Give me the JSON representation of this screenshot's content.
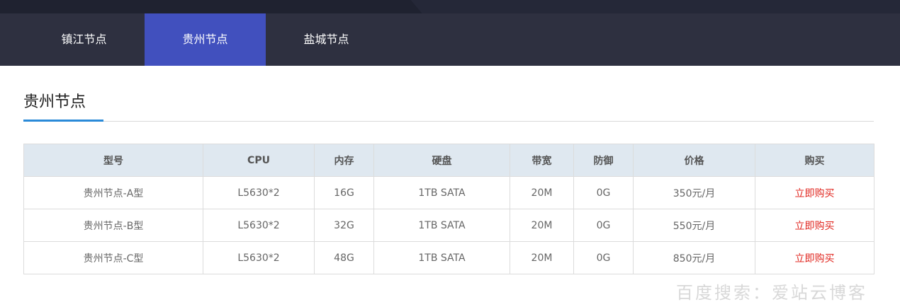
{
  "tabs": [
    {
      "label": "镇江节点",
      "active": false
    },
    {
      "label": "贵州节点",
      "active": true
    },
    {
      "label": "盐城节点",
      "active": false
    }
  ],
  "section": {
    "title": "贵州节点"
  },
  "table": {
    "headers": [
      "型号",
      "CPU",
      "内存",
      "硬盘",
      "带宽",
      "防御",
      "价格",
      "购买"
    ],
    "rows": [
      {
        "model": "贵州节点-A型",
        "cpu": "L5630*2",
        "memory": "16G",
        "disk": "1TB SATA",
        "bandwidth": "20M",
        "defense": "0G",
        "price": "350元/月",
        "buy": "立即购买"
      },
      {
        "model": "贵州节点-B型",
        "cpu": "L5630*2",
        "memory": "32G",
        "disk": "1TB SATA",
        "bandwidth": "20M",
        "defense": "0G",
        "price": "550元/月",
        "buy": "立即购买"
      },
      {
        "model": "贵州节点-C型",
        "cpu": "L5630*2",
        "memory": "48G",
        "disk": "1TB SATA",
        "bandwidth": "20M",
        "defense": "0G",
        "price": "850元/月",
        "buy": "立即购买"
      }
    ]
  },
  "watermark": "百度搜索：爱站云博客",
  "colors": {
    "active_tab": "#4150be",
    "tab_bar": "#2e3040",
    "accent": "#2a8ad8",
    "buy_link": "#e0261f"
  }
}
